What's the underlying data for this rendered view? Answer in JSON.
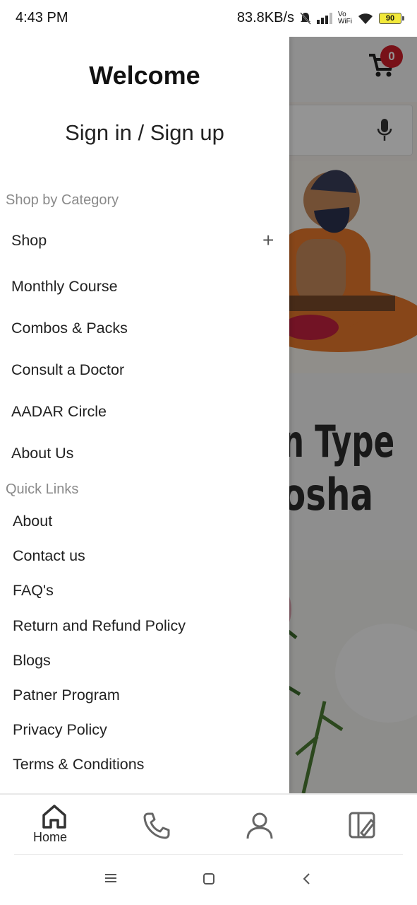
{
  "status_bar": {
    "time": "4:43 PM",
    "speed": "83.8KB/s",
    "wifi_label_top": "Vo",
    "wifi_label_bottom": "WiFi",
    "battery": "90"
  },
  "background": {
    "cart_count": "0",
    "banner_line1": "n Type",
    "banner_line2": "osha"
  },
  "drawer": {
    "title": "Welcome",
    "signin": "Sign in / Sign up",
    "category_heading": "Shop by Category",
    "categories": [
      {
        "label": "Shop",
        "expandable": "+"
      },
      {
        "label": "Monthly Course"
      },
      {
        "label": "Combos & Packs"
      },
      {
        "label": "Consult a Doctor"
      },
      {
        "label": "AADAR Circle"
      },
      {
        "label": "About Us"
      }
    ],
    "quick_links_heading": "Quick Links",
    "quick_links": [
      "About",
      "Contact us",
      "FAQ's",
      "Return and Refund Policy",
      "Blogs",
      "Patner Program",
      "Privacy Policy",
      "Terms & Conditions"
    ]
  },
  "bottom_nav": {
    "home_label": "Home",
    "icons": [
      "home-icon",
      "phone-icon",
      "user-icon",
      "catalog-icon"
    ]
  },
  "system_nav": {
    "icons": [
      "menu-icon",
      "home-square-icon",
      "back-icon"
    ]
  },
  "colors": {
    "accent_badge": "#cf1e2a",
    "overlay": "rgba(0,0,0,0.42)"
  }
}
